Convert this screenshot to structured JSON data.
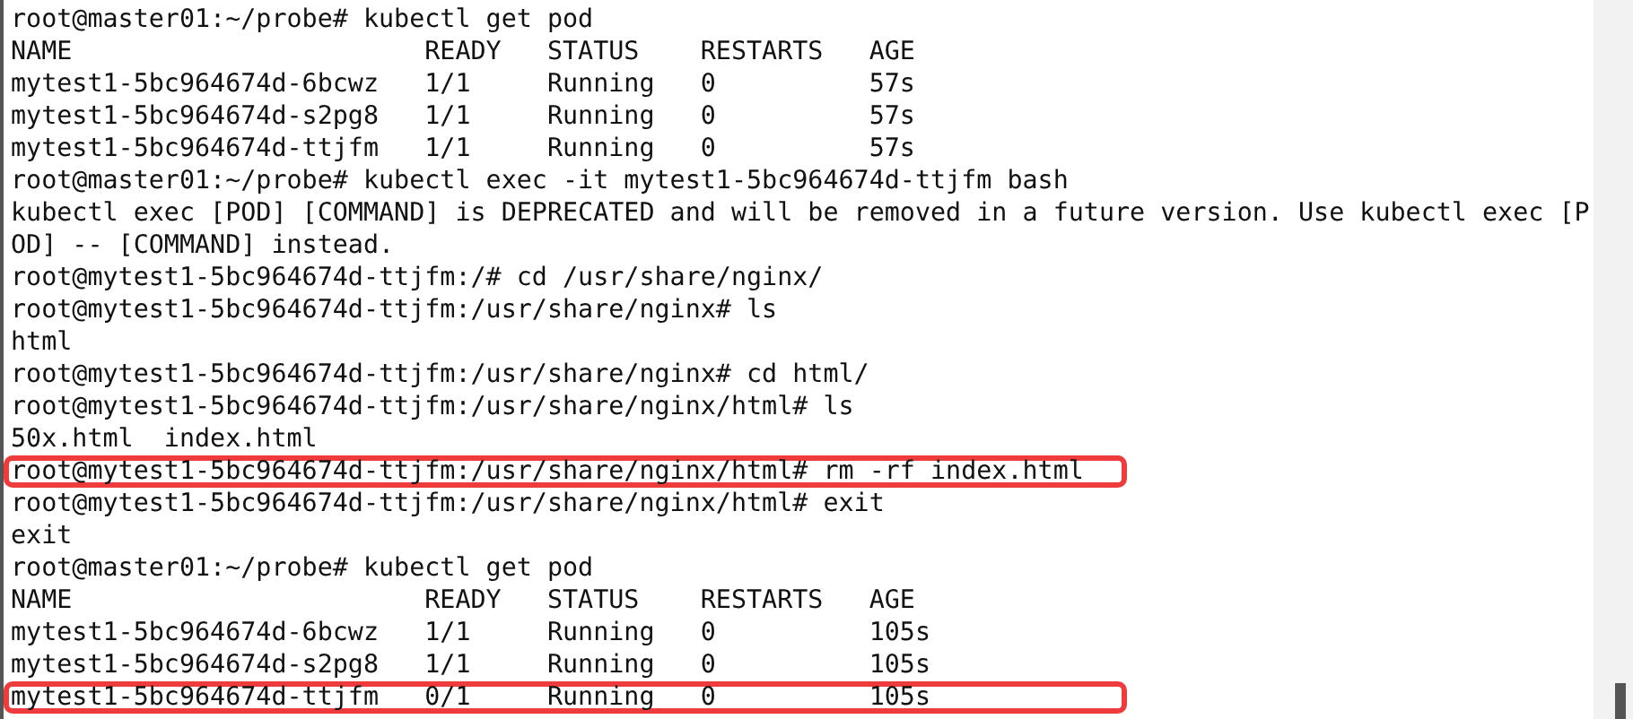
{
  "terminal": {
    "lines": [
      {
        "text": "root@master01:~/probe# kubectl get pod",
        "highlighted": false
      },
      {
        "text": "NAME                       READY   STATUS    RESTARTS   AGE",
        "highlighted": false
      },
      {
        "text": "mytest1-5bc964674d-6bcwz   1/1     Running   0          57s",
        "highlighted": false
      },
      {
        "text": "mytest1-5bc964674d-s2pg8   1/1     Running   0          57s",
        "highlighted": false
      },
      {
        "text": "mytest1-5bc964674d-ttjfm   1/1     Running   0          57s",
        "highlighted": false
      },
      {
        "text": "root@master01:~/probe# kubectl exec -it mytest1-5bc964674d-ttjfm bash",
        "highlighted": false
      },
      {
        "text": "kubectl exec [POD] [COMMAND] is DEPRECATED and will be removed in a future version. Use kubectl exec [P",
        "highlighted": false
      },
      {
        "text": "OD] -- [COMMAND] instead.",
        "highlighted": false
      },
      {
        "text": "root@mytest1-5bc964674d-ttjfm:/# cd /usr/share/nginx/",
        "highlighted": false
      },
      {
        "text": "root@mytest1-5bc964674d-ttjfm:/usr/share/nginx# ls",
        "highlighted": false
      },
      {
        "text": "html",
        "highlighted": false
      },
      {
        "text": "root@mytest1-5bc964674d-ttjfm:/usr/share/nginx# cd html/",
        "highlighted": false
      },
      {
        "text": "root@mytest1-5bc964674d-ttjfm:/usr/share/nginx/html# ls",
        "highlighted": false
      },
      {
        "text": "50x.html  index.html",
        "highlighted": false
      },
      {
        "text": "root@mytest1-5bc964674d-ttjfm:/usr/share/nginx/html# rm -rf index.html",
        "highlighted": true
      },
      {
        "text": "root@mytest1-5bc964674d-ttjfm:/usr/share/nginx/html# exit",
        "highlighted": false
      },
      {
        "text": "exit",
        "highlighted": false
      },
      {
        "text": "root@master01:~/probe# kubectl get pod",
        "highlighted": false
      },
      {
        "text": "NAME                       READY   STATUS    RESTARTS   AGE",
        "highlighted": false
      },
      {
        "text": "mytest1-5bc964674d-6bcwz   1/1     Running   0          105s",
        "highlighted": false
      },
      {
        "text": "mytest1-5bc964674d-s2pg8   1/1     Running   0          105s",
        "highlighted": false
      },
      {
        "text": "mytest1-5bc964674d-ttjfm   0/1     Running   0          105s",
        "highlighted": true
      }
    ]
  }
}
